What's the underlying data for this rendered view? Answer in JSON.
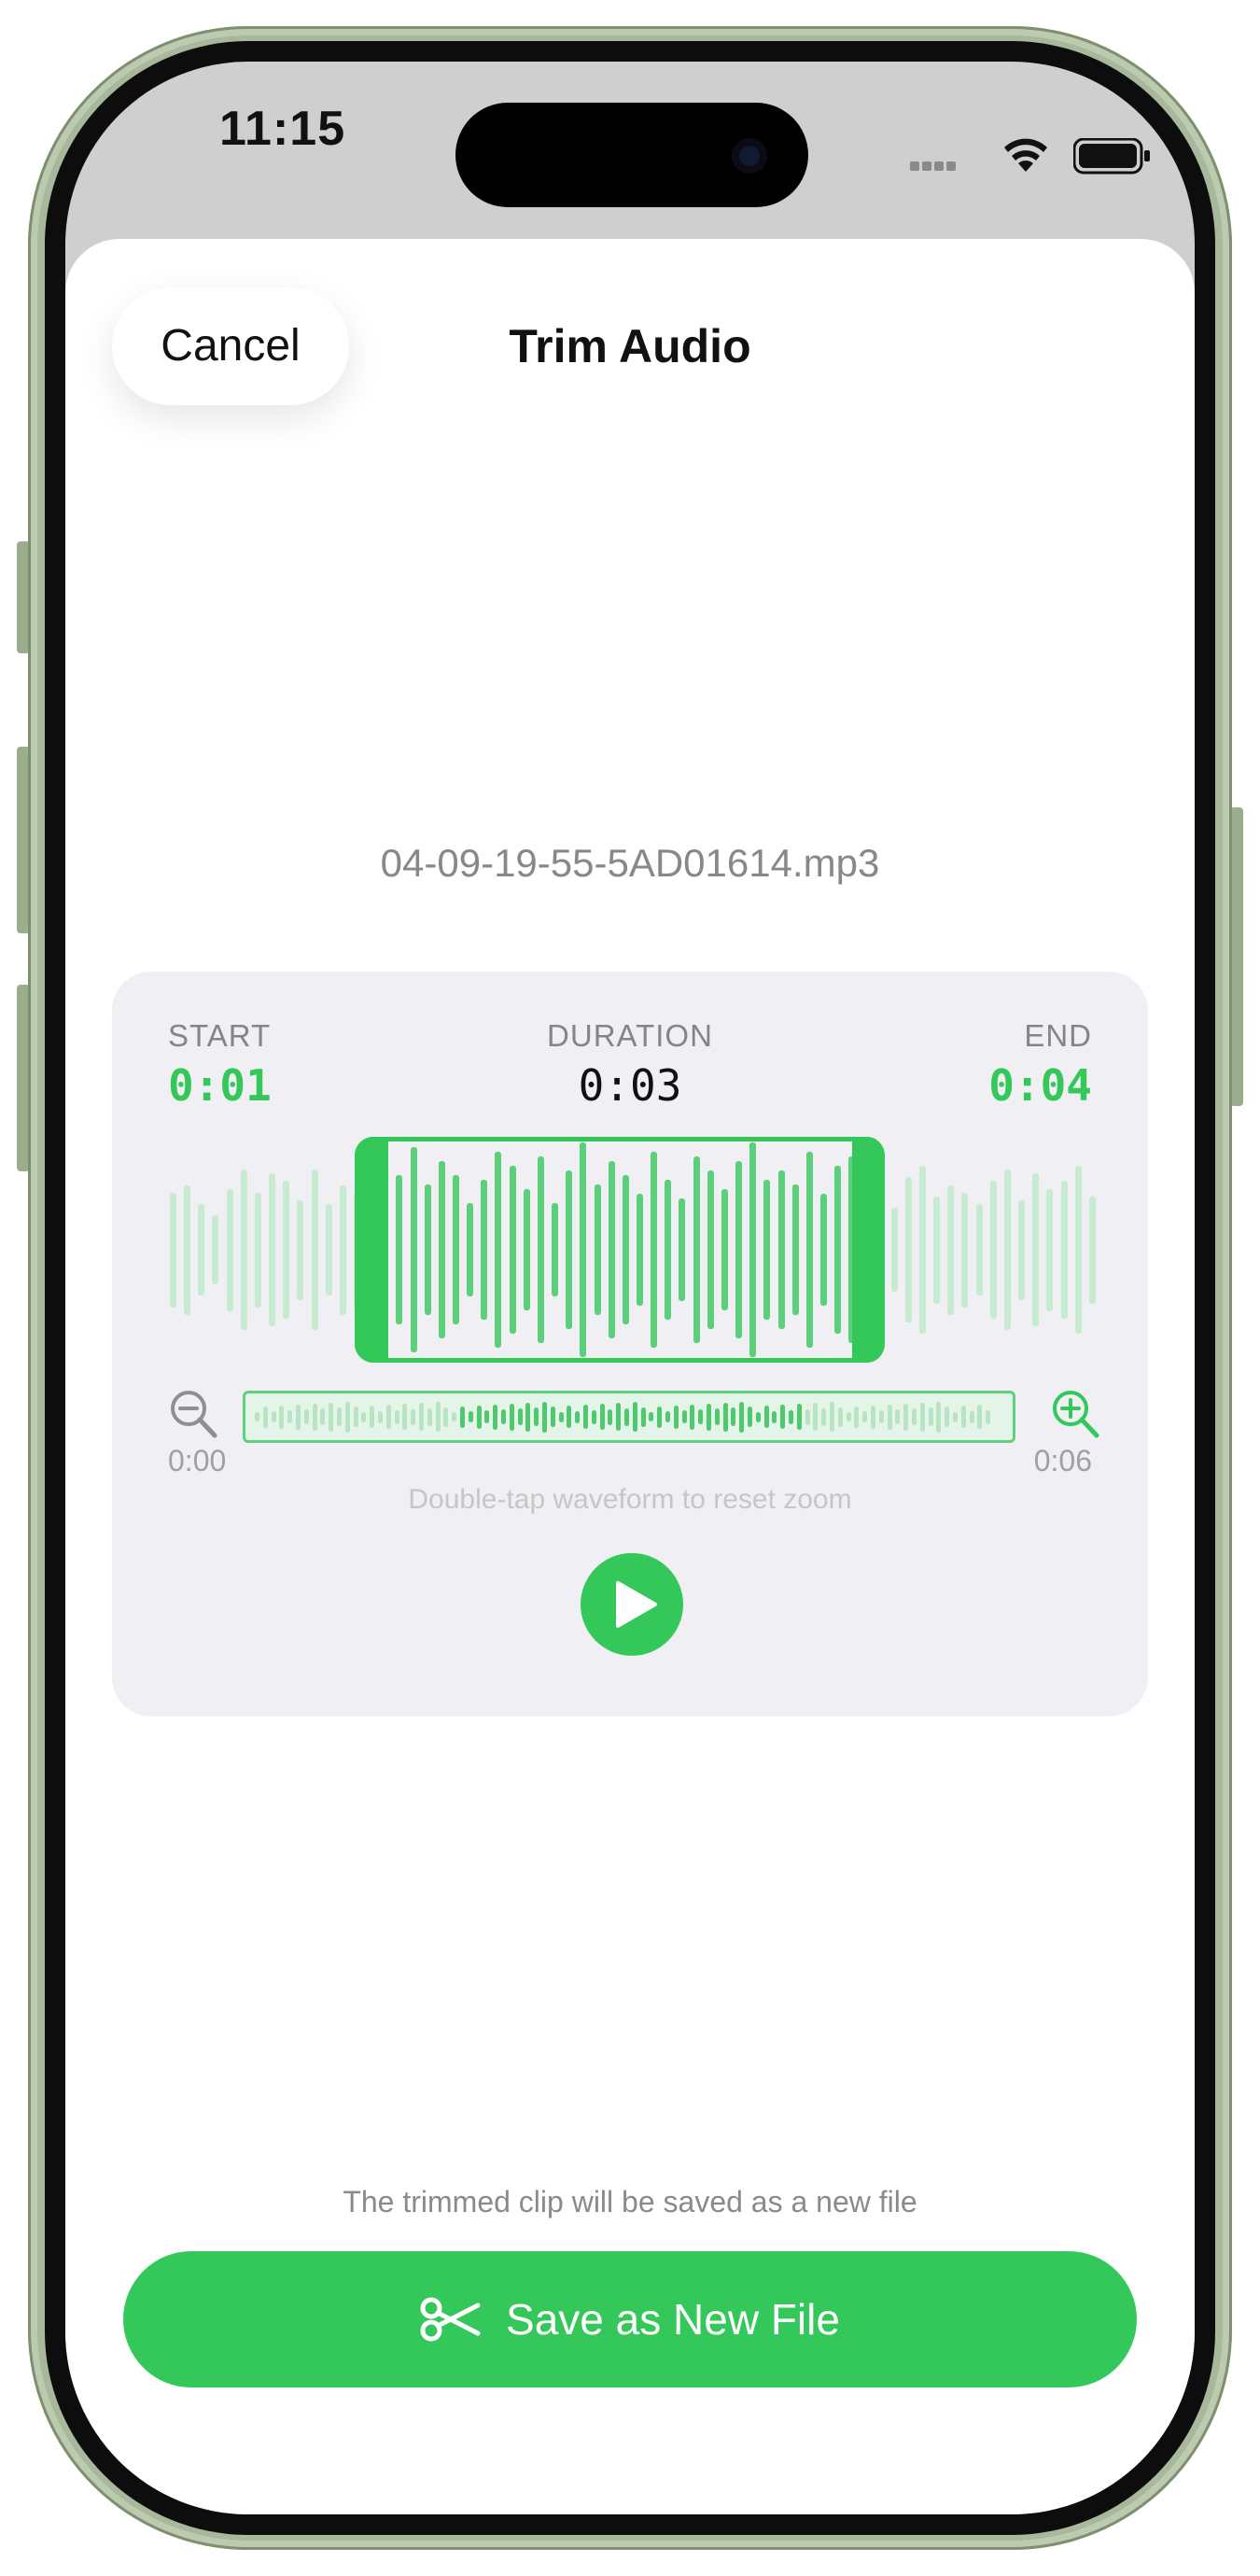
{
  "status_bar": {
    "time": "11:15"
  },
  "header": {
    "cancel_label": "Cancel",
    "title": "Trim Audio"
  },
  "file": {
    "name": "04-09-19-55-5AD01614.mp3"
  },
  "trim": {
    "start_label": "START",
    "start_value": "0:01",
    "duration_label": "DURATION",
    "duration_value": "0:03",
    "end_label": "END",
    "end_value": "0:04",
    "timeline_start": "0:00",
    "timeline_end": "0:06",
    "hint": "Double-tap waveform to reset zoom"
  },
  "footer": {
    "note": "The trimmed clip will be saved as a new file",
    "save_label": "Save as New File"
  },
  "colors": {
    "accent": "#34c759",
    "accent_light": "#c7ebd1",
    "card_bg": "#f0f0f4"
  }
}
